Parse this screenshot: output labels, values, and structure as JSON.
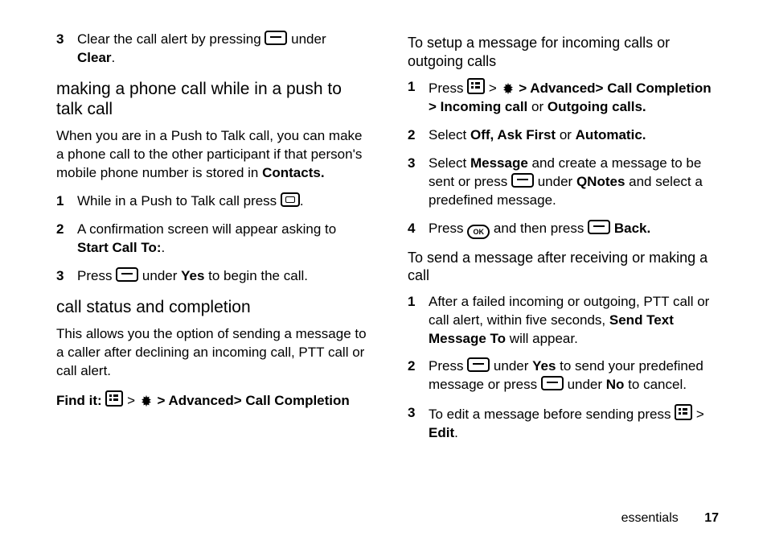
{
  "left": {
    "item3": {
      "num": "3",
      "pre": "Clear the call alert by pressing ",
      "post": " under ",
      "clear": "Clear",
      "period": "."
    },
    "h2": "making a phone call while in a push to talk call",
    "para1_pre": "When you are in a Push to Talk call, you can make a phone call to the other participant if that person's mobile phone number is stored in ",
    "para1_bold": "Contacts.",
    "list2": {
      "i1": {
        "num": "1",
        "text": "While in a Push to Talk call press ",
        "period": "."
      },
      "i2": {
        "num": "2",
        "pre": "A confirmation screen will appear asking to ",
        "bold": "Start Call To:",
        "period": "."
      },
      "i3": {
        "num": "3",
        "pre": "Press ",
        "mid": " under ",
        "bold": "Yes",
        "post": " to begin the call."
      }
    },
    "h2b": "call status and completion",
    "para2": "This allows you the option of sending a message to a caller after declining an incoming call, PTT call or call alert.",
    "findit_label": "Find it: ",
    "findit_path": " > Advanced> Call Completion"
  },
  "right": {
    "h3a": "To setup a message for incoming calls or outgoing calls",
    "listA": {
      "i1": {
        "num": "1",
        "pre": "Press ",
        "path1": " > Advanced> Call Completion > Incoming call",
        "or": " or ",
        "path2": "Outgoing calls."
      },
      "i2": {
        "num": "2",
        "pre": "Select ",
        "opts": "Off, Ask First",
        "or": " or ",
        "opt3": "Automatic."
      },
      "i3": {
        "num": "3",
        "pre": "Select ",
        "msg": "Message",
        "mid": " and create a message to be sent or press ",
        "under": " under ",
        "qn": "QNotes",
        "post": " and select a predefined message."
      },
      "i4": {
        "num": "4",
        "pre": "Press ",
        "mid": " and then press ",
        "back": "Back."
      }
    },
    "h3b": "To send a message after receiving or making a call",
    "listB": {
      "i1": {
        "num": "1",
        "pre": "After a failed incoming or outgoing, PTT call or call alert, within five seconds, ",
        "bold": "Send Text Message To",
        "post": " will appear."
      },
      "i2": {
        "num": "2",
        "pre": "Press ",
        "u1": " under ",
        "yes": "Yes",
        "mid": " to send your predefined message or press ",
        "u2": " under ",
        "no": "No",
        "post": " to cancel."
      },
      "i3": {
        "num": "3",
        "pre": "To edit a message before sending press ",
        "gt": " > ",
        "edit": "Edit",
        "period": "."
      }
    }
  },
  "footer": {
    "section": "essentials",
    "page": "17"
  }
}
